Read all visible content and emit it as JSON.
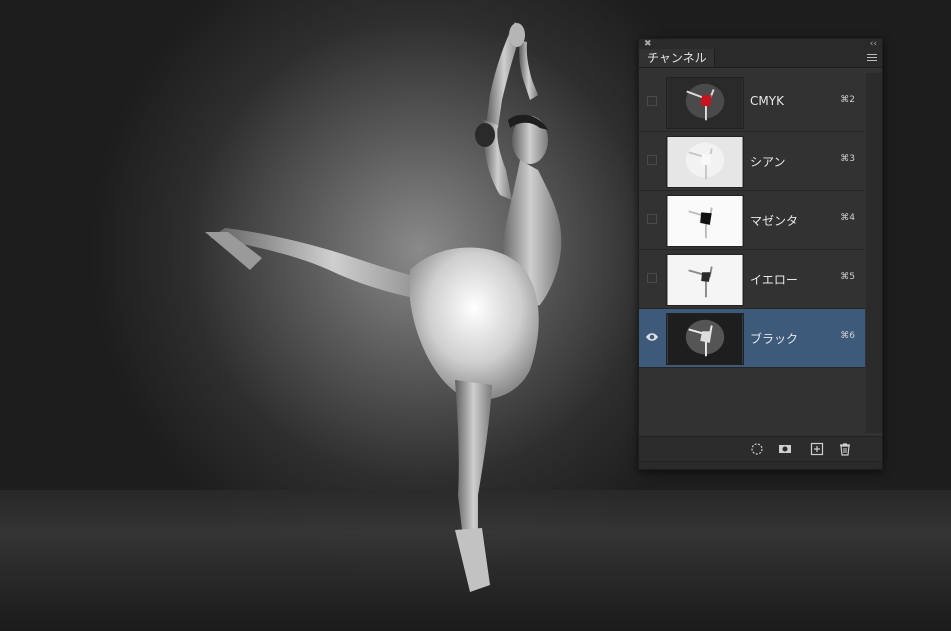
{
  "panel": {
    "tab_label": "チャンネル",
    "channels": [
      {
        "label": "CMYK",
        "shortcut": "⌘2",
        "visible": false
      },
      {
        "label": "シアン",
        "shortcut": "⌘3",
        "visible": false
      },
      {
        "label": "マゼンタ",
        "shortcut": "⌘4",
        "visible": false
      },
      {
        "label": "イエロー",
        "shortcut": "⌘5",
        "visible": false
      },
      {
        "label": "ブラック",
        "shortcut": "⌘6",
        "visible": true,
        "selected": true
      }
    ],
    "footer_icons": [
      "load-selection-icon",
      "save-selection-icon",
      "new-channel-icon",
      "trash-icon"
    ]
  },
  "colors": {
    "selected_row": "#3d5a7a",
    "panel_bg": "#323232",
    "accent_red": "#c8141e"
  }
}
